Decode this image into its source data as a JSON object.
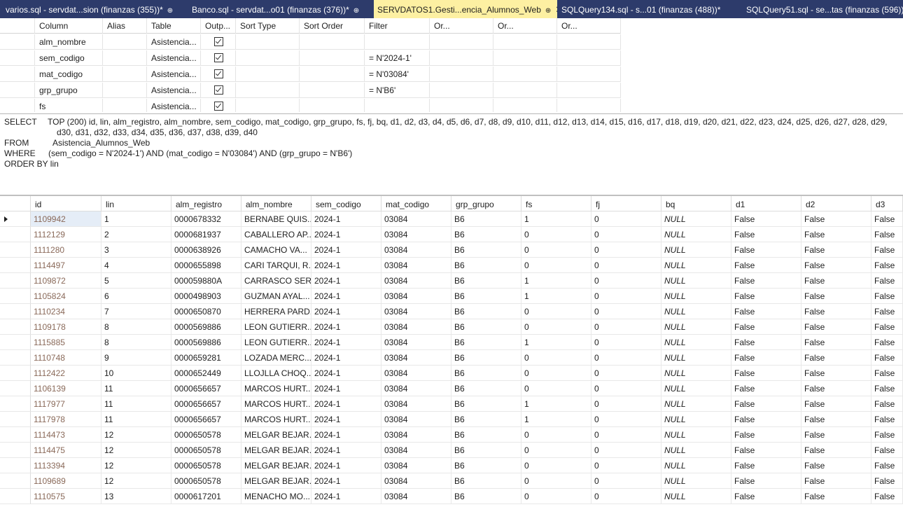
{
  "tabs": [
    {
      "label": "varios.sql - servdat...sion (finanzas (355))*",
      "pin": "⊕",
      "close": ""
    },
    {
      "label": "Banco.sql - servdat...o01 (finanzas (376))*",
      "pin": "⊕",
      "close": ""
    },
    {
      "label": "SERVDATOS1.Gesti...encia_Alumnos_Web",
      "pin": "⊕",
      "close": "✕",
      "active": true
    },
    {
      "label": "SQLQuery134.sql - s...01 (finanzas (488))*",
      "pin": "",
      "close": ""
    },
    {
      "label": "SQLQuery51.sql - se...tas (finanzas (596))*",
      "pin": "",
      "close": ""
    }
  ],
  "criteria": {
    "headers": [
      "Column",
      "Alias",
      "Table",
      "Outp...",
      "Sort Type",
      "Sort Order",
      "Filter",
      "Or...",
      "Or...",
      "Or..."
    ],
    "rows": [
      {
        "column": "alm_nombre",
        "alias": "",
        "table": "Asistencia...",
        "output": true,
        "sort_type": "",
        "sort_order": "",
        "filter": ""
      },
      {
        "column": "sem_codigo",
        "alias": "",
        "table": "Asistencia...",
        "output": true,
        "sort_type": "",
        "sort_order": "",
        "filter": "= N'2024-1'"
      },
      {
        "column": "mat_codigo",
        "alias": "",
        "table": "Asistencia...",
        "output": true,
        "sort_type": "",
        "sort_order": "",
        "filter": "= N'03084'"
      },
      {
        "column": "grp_grupo",
        "alias": "",
        "table": "Asistencia...",
        "output": true,
        "sort_type": "",
        "sort_order": "",
        "filter": "= N'B6'"
      },
      {
        "column": "fs",
        "alias": "",
        "table": "Asistencia...",
        "output": true,
        "sort_type": "",
        "sort_order": "",
        "filter": ""
      }
    ]
  },
  "sql": {
    "select_kw": "SELECT",
    "select_line1": "TOP (200) id, lin, alm_registro, alm_nombre, sem_codigo, mat_codigo, grp_grupo, fs, fj, bq, d1, d2, d3, d4, d5, d6, d7, d8, d9, d10, d11, d12, d13, d14, d15, d16, d17, d18, d19, d20, d21, d22, d23, d24, d25, d26, d27, d28, d29,",
    "select_line2": "d30, d31, d32, d33, d34, d35, d36, d37, d38, d39, d40",
    "from_kw": "FROM",
    "from_text": "Asistencia_Alumnos_Web",
    "where_kw": "WHERE",
    "where_text": "(sem_codigo = N'2024-1') AND (mat_codigo = N'03084') AND (grp_grupo = N'B6')",
    "orderby_text": "ORDER BY lin"
  },
  "results": {
    "columns": [
      "id",
      "lin",
      "alm_registro",
      "alm_nombre",
      "sem_codigo",
      "mat_codigo",
      "grp_grupo",
      "fs",
      "fj",
      "bq",
      "d1",
      "d2",
      "d3"
    ],
    "rows": [
      [
        "1109942",
        "1",
        "0000678332",
        "BERNABE QUIS...",
        "2024-1",
        "03084",
        "B6",
        "1",
        "0",
        "NULL",
        "False",
        "False",
        "False"
      ],
      [
        "1112129",
        "2",
        "0000681937",
        "CABALLERO AP...",
        "2024-1",
        "03084",
        "B6",
        "0",
        "0",
        "NULL",
        "False",
        "False",
        "False"
      ],
      [
        "1111280",
        "3",
        "0000638926",
        "CAMACHO VA...",
        "2024-1",
        "03084",
        "B6",
        "0",
        "0",
        "NULL",
        "False",
        "False",
        "False"
      ],
      [
        "1114497",
        "4",
        "0000655898",
        "CARI TARQUI, R...",
        "2024-1",
        "03084",
        "B6",
        "0",
        "0",
        "NULL",
        "False",
        "False",
        "False"
      ],
      [
        "1109872",
        "5",
        "000059880A",
        "CARRASCO SER...",
        "2024-1",
        "03084",
        "B6",
        "1",
        "0",
        "NULL",
        "False",
        "False",
        "False"
      ],
      [
        "1105824",
        "6",
        "0000498903",
        "GUZMAN AYAL...",
        "2024-1",
        "03084",
        "B6",
        "1",
        "0",
        "NULL",
        "False",
        "False",
        "False"
      ],
      [
        "1110234",
        "7",
        "0000650870",
        "HERRERA PARD...",
        "2024-1",
        "03084",
        "B6",
        "0",
        "0",
        "NULL",
        "False",
        "False",
        "False"
      ],
      [
        "1109178",
        "8",
        "0000569886",
        "LEON GUTIERR...",
        "2024-1",
        "03084",
        "B6",
        "0",
        "0",
        "NULL",
        "False",
        "False",
        "False"
      ],
      [
        "1115885",
        "8",
        "0000569886",
        "LEON GUTIERR...",
        "2024-1",
        "03084",
        "B6",
        "1",
        "0",
        "NULL",
        "False",
        "False",
        "False"
      ],
      [
        "1110748",
        "9",
        "0000659281",
        "LOZADA MERC...",
        "2024-1",
        "03084",
        "B6",
        "0",
        "0",
        "NULL",
        "False",
        "False",
        "False"
      ],
      [
        "1112422",
        "10",
        "0000652449",
        "LLOJLLA CHOQ...",
        "2024-1",
        "03084",
        "B6",
        "0",
        "0",
        "NULL",
        "False",
        "False",
        "False"
      ],
      [
        "1106139",
        "11",
        "0000656657",
        "MARCOS HURT...",
        "2024-1",
        "03084",
        "B6",
        "0",
        "0",
        "NULL",
        "False",
        "False",
        "False"
      ],
      [
        "1117977",
        "11",
        "0000656657",
        "MARCOS HURT...",
        "2024-1",
        "03084",
        "B6",
        "1",
        "0",
        "NULL",
        "False",
        "False",
        "False"
      ],
      [
        "1117978",
        "11",
        "0000656657",
        "MARCOS HURT...",
        "2024-1",
        "03084",
        "B6",
        "1",
        "0",
        "NULL",
        "False",
        "False",
        "False"
      ],
      [
        "1114473",
        "12",
        "0000650578",
        "MELGAR BEJAR...",
        "2024-1",
        "03084",
        "B6",
        "0",
        "0",
        "NULL",
        "False",
        "False",
        "False"
      ],
      [
        "1114475",
        "12",
        "0000650578",
        "MELGAR BEJAR...",
        "2024-1",
        "03084",
        "B6",
        "0",
        "0",
        "NULL",
        "False",
        "False",
        "False"
      ],
      [
        "1113394",
        "12",
        "0000650578",
        "MELGAR BEJAR...",
        "2024-1",
        "03084",
        "B6",
        "0",
        "0",
        "NULL",
        "False",
        "False",
        "False"
      ],
      [
        "1109689",
        "12",
        "0000650578",
        "MELGAR BEJAR...",
        "2024-1",
        "03084",
        "B6",
        "0",
        "0",
        "NULL",
        "False",
        "False",
        "False"
      ],
      [
        "1110575",
        "13",
        "0000617201",
        "MENACHO MO...",
        "2024-1",
        "03084",
        "B6",
        "0",
        "0",
        "NULL",
        "False",
        "False",
        "False"
      ]
    ]
  }
}
